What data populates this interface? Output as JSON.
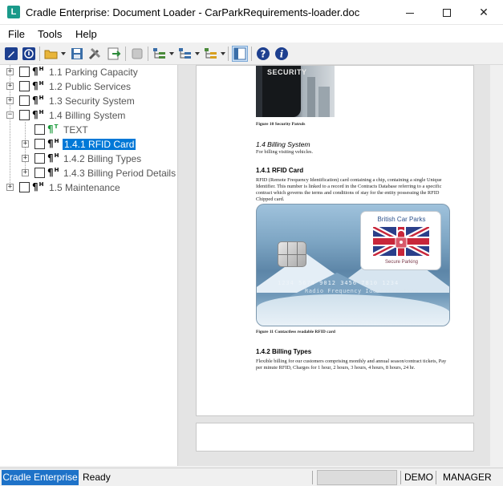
{
  "window": {
    "title": "Cradle Enterprise: Document Loader - CarParkRequirements-loader.doc",
    "app_icon_letter": "L",
    "minimize_icon": "minimize-icon",
    "maximize_icon": "maximize-icon",
    "close_glyph": "✕"
  },
  "menu": {
    "items": [
      "File",
      "Tools",
      "Help"
    ]
  },
  "toolbar": {
    "buttons": [
      "edit-icon",
      "info-icon",
      "open-folder-icon",
      "save-icon",
      "tools-icon",
      "export-icon",
      "stop-icon",
      "tree-expand-icon",
      "tree-collapse-icon",
      "tree-options-icon",
      "panel-toggle-icon",
      "help-icon",
      "about-icon"
    ]
  },
  "tree": {
    "items": [
      {
        "label": "1.1 Parking Capacity",
        "marker": "H",
        "expanded": false,
        "selected": false
      },
      {
        "label": "1.2 Public Services",
        "marker": "H",
        "expanded": false,
        "selected": false
      },
      {
        "label": "1.3 Security System",
        "marker": "H",
        "expanded": false,
        "selected": false
      },
      {
        "label": "1.4 Billing System",
        "marker": "H",
        "expanded": true,
        "selected": false
      },
      {
        "label": "TEXT",
        "marker": "T",
        "expanded": null,
        "selected": false
      },
      {
        "label": "1.4.1 RFID Card",
        "marker": "H",
        "expanded": false,
        "selected": true
      },
      {
        "label": "1.4.2 Billing Types",
        "marker": "H",
        "expanded": false,
        "selected": false
      },
      {
        "label": "1.4.3 Billing Period Details",
        "marker": "H",
        "expanded": false,
        "selected": false
      },
      {
        "label": "1.5 Maintenance",
        "marker": "H",
        "expanded": false,
        "selected": false
      }
    ]
  },
  "document": {
    "photo_text": "SECURITY",
    "figure10_caption": "Figure 10 Security Patrols",
    "section_billing_title": "1.4  Billing System",
    "section_billing_body": "For billing visiting vehicles.",
    "section_rfid_title": "1.4.1  RFID Card",
    "section_rfid_body": "RFID (Remote Frequency Identification) card containing a chip, containing a single Unique Identifier. This number is linked to a record in the Contracts Database referring to a specific contract which governs the terms and conditions of stay for the entity possessing the RFID Chipped card.",
    "card": {
      "brand_title": "British Car Parks",
      "brand_subtitle": "Secure Parking",
      "number": "1234 5678 9012 3456 7810 1234",
      "number_caption": "Radio Frequency Identification"
    },
    "figure11_caption": "Figure 11 Contactless readable RFID card",
    "section_types_title": "1.4.2  Billing Types",
    "section_types_body": "Flexible billing for our customers comprising  monthly and annual season/contract tickets, Pay per minute RFID, Charges for 1 hour, 2 hours, 3 hours, 4 hours, 8 hours, 24 hr."
  },
  "status": {
    "brand": "Cradle Enterprise",
    "state": "Ready",
    "mode": "DEMO",
    "role": "MANAGER"
  },
  "colors": {
    "selection": "#0078d7",
    "status_brand": "#1e72c8",
    "pilcrow_heading": "#000000",
    "pilcrow_text": "#1a9a3a"
  }
}
